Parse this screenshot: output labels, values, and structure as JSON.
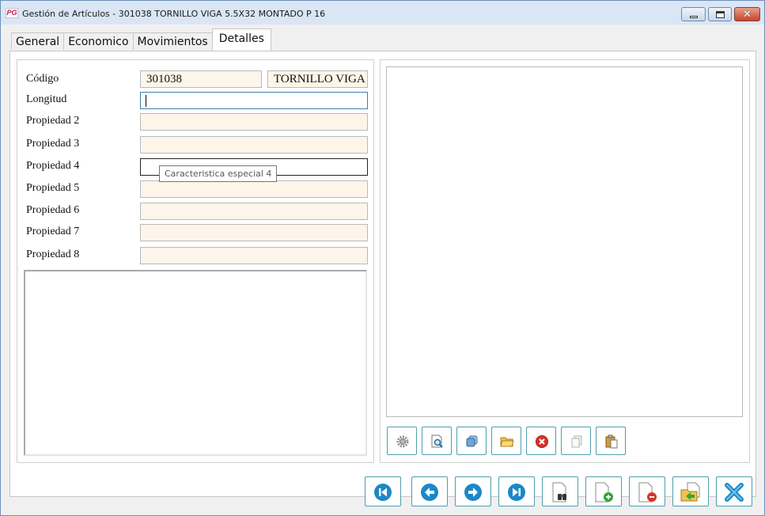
{
  "window": {
    "icon_text": "PG",
    "title": "Gestión de Artículos - 301038 TORNILLO VIGA 5.5X32 MONTADO P 16"
  },
  "tabs": [
    {
      "label": "General"
    },
    {
      "label": "Economico"
    },
    {
      "label": "Movimientos"
    },
    {
      "label": "Detalles"
    }
  ],
  "active_tab": "Detalles",
  "form": {
    "codigo_label": "Código",
    "codigo_value": "301038",
    "descripcion_value": "TORNILLO VIGA",
    "longitud_label": "Longitud",
    "longitud_value": "",
    "propiedad2_label": "Propiedad 2",
    "propiedad3_label": "Propiedad 3",
    "propiedad4_label": "Propiedad 4",
    "propiedad5_label": "Propiedad 5",
    "propiedad6_label": "Propiedad 6",
    "propiedad7_label": "Propiedad 7",
    "propiedad8_label": "Propiedad 8",
    "tooltip": "Caracteristica especial 4"
  },
  "image_toolbar": [
    "gear-icon",
    "preview-icon",
    "copy-layers-icon",
    "open-folder-icon",
    "delete-icon",
    "copy-icon",
    "paste-icon"
  ],
  "nav_toolbar": [
    "first-record-icon",
    "previous-record-icon",
    "next-record-icon",
    "last-record-icon",
    "search-icon",
    "new-record-icon",
    "delete-record-icon",
    "open-record-icon",
    "close-icon"
  ],
  "colors": {
    "field_background": "#fdf5e9",
    "button_border": "#4f9fae",
    "accent_blue": "#1c88c7"
  }
}
